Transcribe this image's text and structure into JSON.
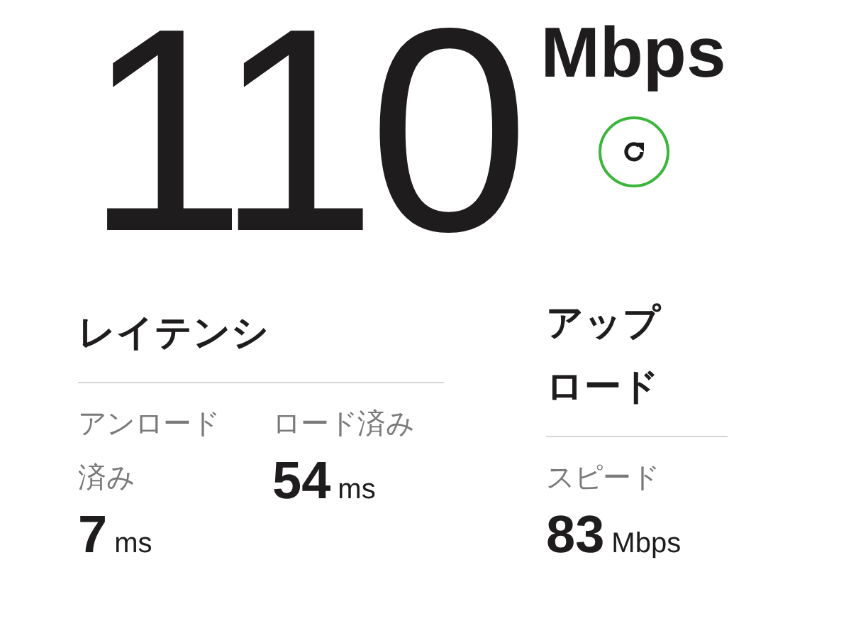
{
  "speed": {
    "value": "110",
    "unit": "Mbps"
  },
  "latency": {
    "title": "レイテンシ",
    "metrics": [
      {
        "label": "アンロード済み",
        "value": "7",
        "unit": "ms"
      },
      {
        "label": "ロード済み",
        "value": "54",
        "unit": "ms"
      }
    ]
  },
  "upload": {
    "title": "アップロード",
    "metrics": [
      {
        "label": "スピード",
        "value": "83",
        "unit": "Mbps"
      }
    ]
  }
}
